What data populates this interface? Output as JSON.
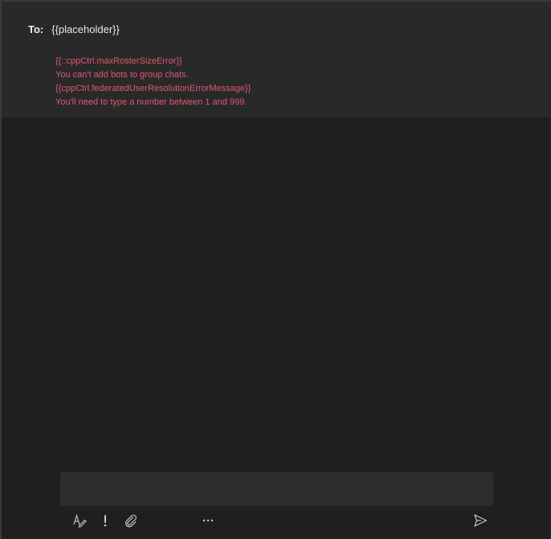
{
  "recipient": {
    "label": "To:",
    "value": "{{placeholder}}"
  },
  "errors": [
    "{{::cppCtrl.maxRosterSizeError}}",
    "You can't add bots to group chats.",
    "{{cppCtrl.federatedUserResolutionErrorMessage}}",
    "You'll need to type a number between 1 and 999."
  ],
  "compose": {
    "value": ""
  },
  "toolbar": {
    "icons": [
      "format-icon",
      "important-icon",
      "attach-icon",
      "more-options-icon",
      "send-icon"
    ]
  },
  "colors": {
    "background": "#1f1f1f",
    "header": "#292929",
    "error": "#e2576f",
    "compose": "#2d2d2d",
    "icon": "#c8c8c8"
  }
}
